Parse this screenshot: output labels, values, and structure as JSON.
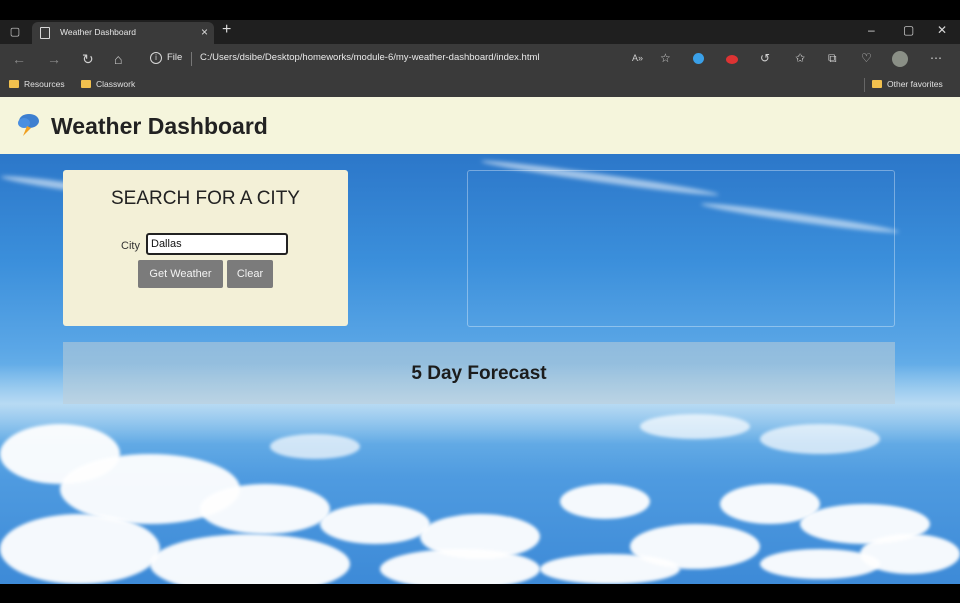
{
  "browser": {
    "tab_title": "Weather Dashboard",
    "file_label": "File",
    "url": "C:/Users/dsibe/Desktop/homeworks/module-6/my-weather-dashboard/index.html",
    "bookmarks": [
      "Resources",
      "Classwork"
    ],
    "other_favorites": "Other favorites"
  },
  "header": {
    "title": "Weather Dashboard"
  },
  "search": {
    "heading": "SEARCH FOR A CITY",
    "city_label": "City",
    "city_value": "Dallas",
    "get_weather_label": "Get Weather",
    "clear_label": "Clear"
  },
  "forecast": {
    "heading": "5 Day Forecast"
  },
  "colors": {
    "header_bg": "#f5f5dc",
    "card_bg": "#f3f0d7",
    "button_bg": "#7b7b7b"
  }
}
